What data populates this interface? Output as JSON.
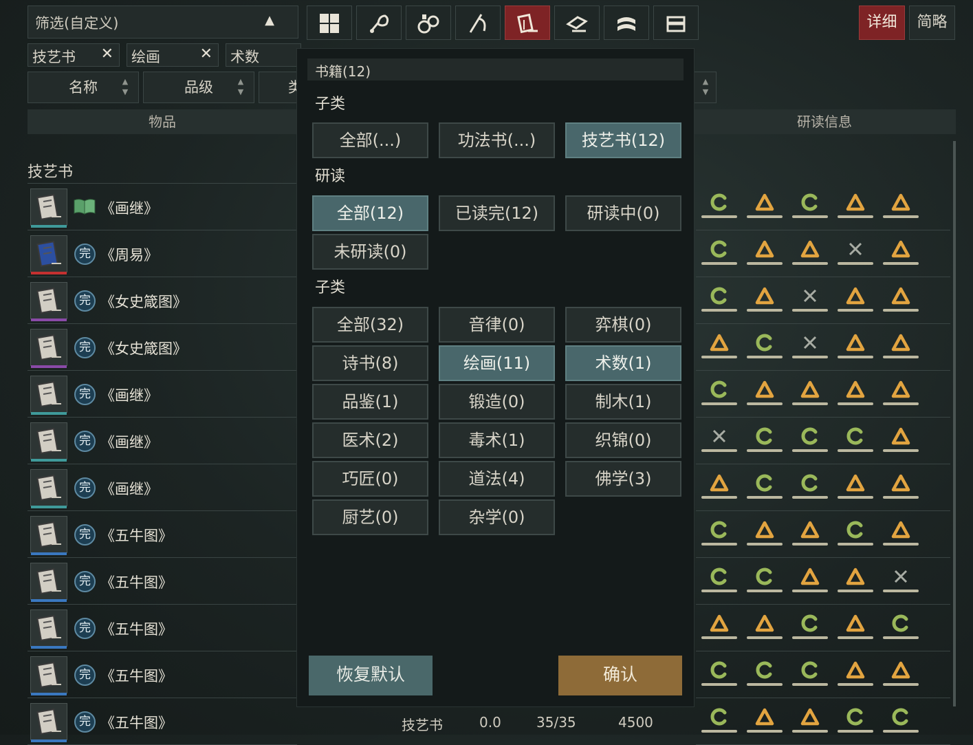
{
  "filter": {
    "label": "筛选(自定义)"
  },
  "categories": [
    {
      "icon": "all-grid-icon"
    },
    {
      "icon": "food-icon"
    },
    {
      "icon": "medicine-icon"
    },
    {
      "icon": "weapon-icon"
    },
    {
      "icon": "book-icon"
    },
    {
      "icon": "material-icon"
    },
    {
      "icon": "cloth-icon"
    },
    {
      "icon": "chest-icon"
    }
  ],
  "view_modes": {
    "detail": "详细",
    "simple": "简略"
  },
  "tags": [
    "技艺书",
    "绘画",
    "术数"
  ],
  "sort": {
    "name": "名称",
    "grade": "品级",
    "type_partial": "类"
  },
  "columns": {
    "item": "物品",
    "research": "研读信息"
  },
  "section_title": "技艺书",
  "rows": [
    {
      "name": "《画继》",
      "status": "book",
      "grade_color": "#3f9a9a"
    },
    {
      "name": "《周易》",
      "status": "完",
      "grade_color": "#c43030"
    },
    {
      "name": "《女史箴图》",
      "status": "完",
      "grade_color": "#8a4aa8"
    },
    {
      "name": "《女史箴图》",
      "status": "完",
      "grade_color": "#8a4aa8"
    },
    {
      "name": "《画继》",
      "status": "完",
      "grade_color": "#3f9a9a"
    },
    {
      "name": "《画继》",
      "status": "完",
      "grade_color": "#3f9a9a"
    },
    {
      "name": "《画继》",
      "status": "完",
      "grade_color": "#3f9a9a"
    },
    {
      "name": "《五牛图》",
      "status": "完",
      "grade_color": "#3a78c0"
    },
    {
      "name": "《五牛图》",
      "status": "完",
      "grade_color": "#3a78c0"
    },
    {
      "name": "《五牛图》",
      "status": "完",
      "grade_color": "#3a78c0"
    },
    {
      "name": "《五牛图》",
      "status": "完",
      "grade_color": "#3a78c0"
    },
    {
      "name": "《五牛图》",
      "status": "完",
      "grade_color": "#3a78c0"
    }
  ],
  "research": [
    [
      "c",
      "a",
      "c",
      "a",
      "a"
    ],
    [
      "c",
      "a",
      "a",
      "x",
      "a"
    ],
    [
      "c",
      "a",
      "x",
      "a",
      "a"
    ],
    [
      "a",
      "c",
      "x",
      "a",
      "a"
    ],
    [
      "c",
      "a",
      "a",
      "a",
      "a"
    ],
    [
      "x",
      "c",
      "c",
      "c",
      "a"
    ],
    [
      "a",
      "c",
      "c",
      "a",
      "a"
    ],
    [
      "c",
      "a",
      "a",
      "c",
      "a"
    ],
    [
      "c",
      "c",
      "a",
      "a",
      "x"
    ],
    [
      "a",
      "a",
      "c",
      "a",
      "c"
    ],
    [
      "c",
      "c",
      "c",
      "a",
      "a"
    ],
    [
      "c",
      "a",
      "a",
      "c",
      "c"
    ]
  ],
  "bottom_row": {
    "type": "技艺书",
    "v1": "0.0",
    "v2": "35/35",
    "v3": "4500"
  },
  "popup": {
    "header": "书籍(12)",
    "sec1_title": "子类",
    "sec1": [
      "全部(...)",
      "功法书(...)",
      "技艺书(12)"
    ],
    "sec2_title": "研读",
    "sec2": [
      "全部(12)",
      "已读完(12)",
      "研读中(0)",
      "未研读(0)"
    ],
    "sec3_title": "子类",
    "sec3": [
      "全部(32)",
      "音律(0)",
      "弈棋(0)",
      "诗书(8)",
      "绘画(11)",
      "术数(1)",
      "品鉴(1)",
      "锻造(0)",
      "制木(1)",
      "医术(2)",
      "毒术(1)",
      "织锦(0)",
      "巧匠(0)",
      "道法(4)",
      "佛学(3)",
      "厨艺(0)",
      "杂学(0)"
    ],
    "reset": "恢复默认",
    "confirm": "确认"
  },
  "colors": {
    "accent_red": "#7e2325",
    "selected_teal": "#49676b",
    "confirm_gold": "#8e6b38",
    "arc_green": "#9ab85a",
    "tri_orange": "#e2a440",
    "cross_gray": "#a8aca4"
  }
}
